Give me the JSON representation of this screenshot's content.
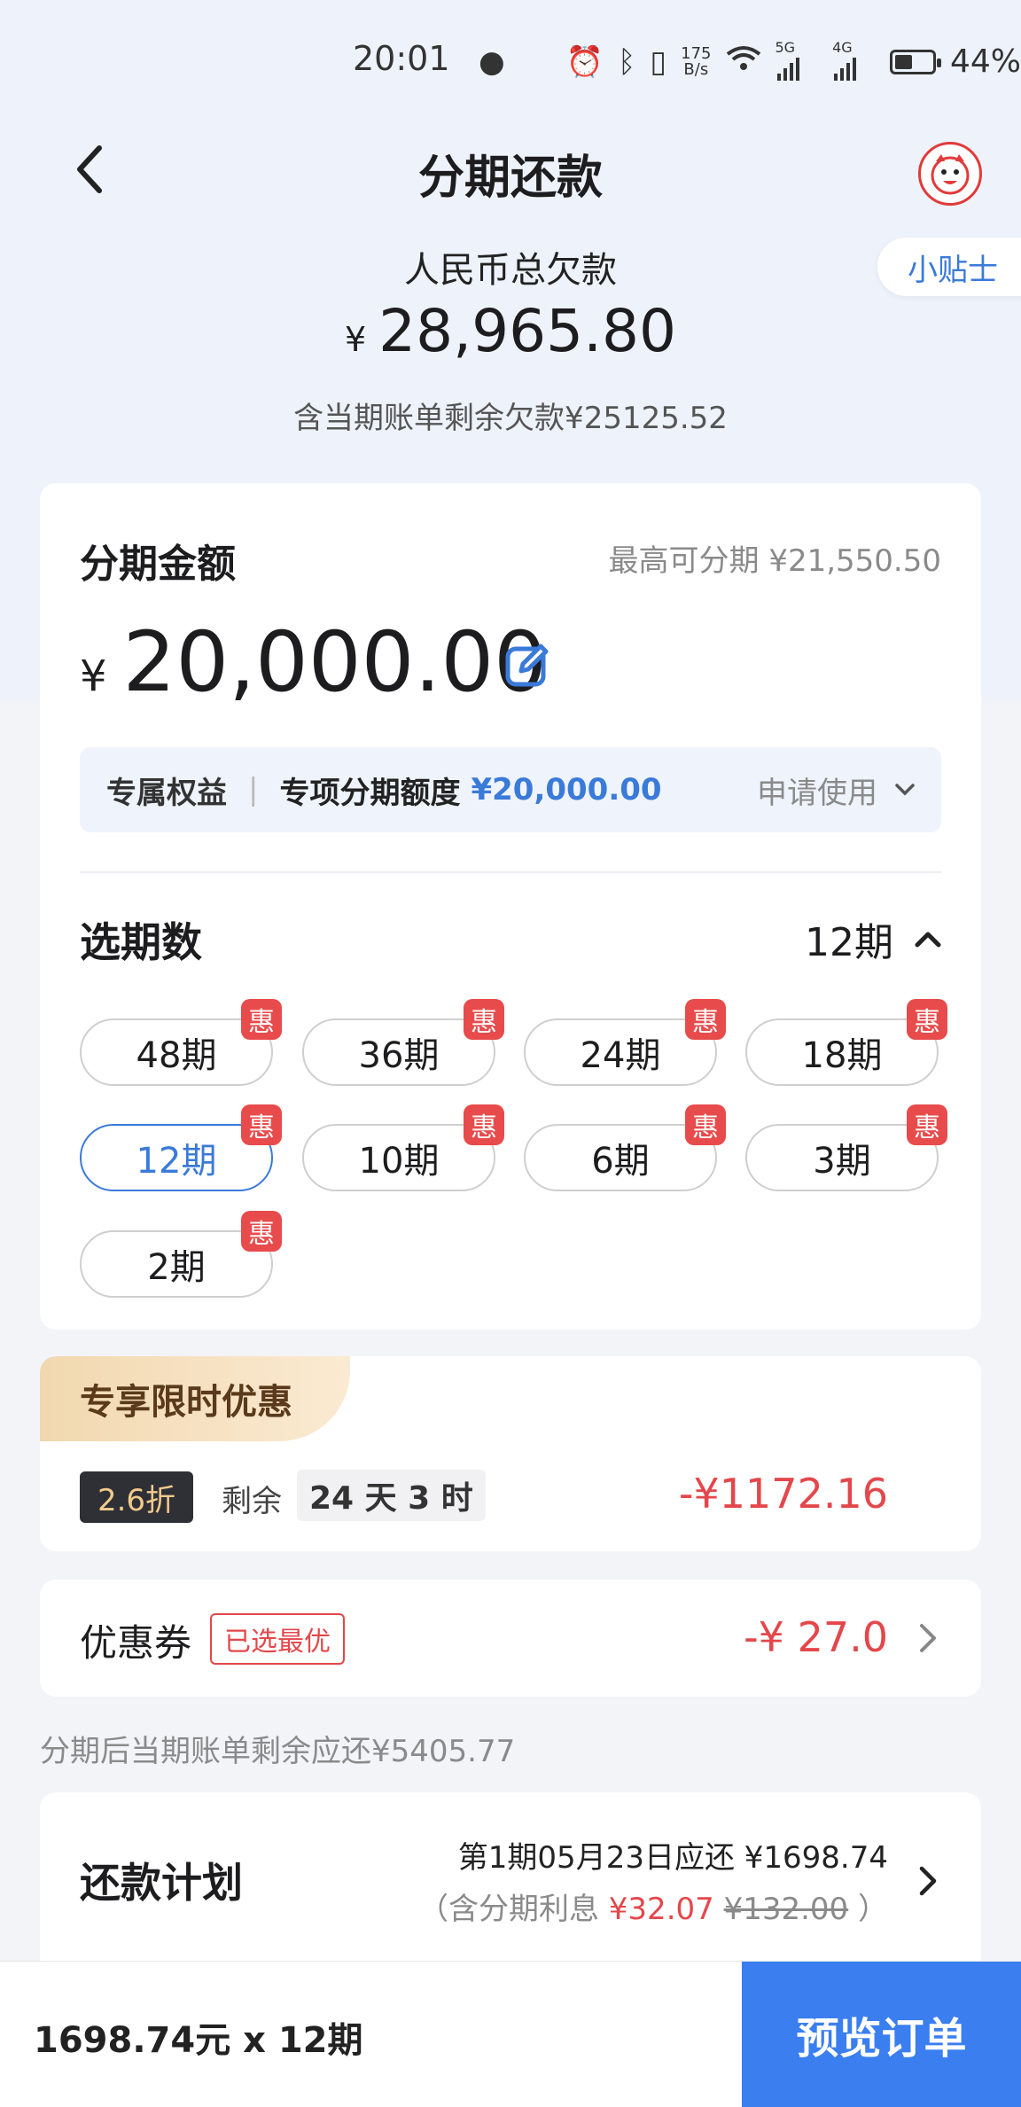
{
  "status_bar": {
    "time": "20:01",
    "net_speed_top": "175",
    "net_speed_bottom": "B/s",
    "signal_5g": "5G",
    "signal_4g": "4G",
    "battery_percent": "44%",
    "battery_level": 0.44
  },
  "nav": {
    "title": "分期还款"
  },
  "tip_button": "小贴士",
  "debt": {
    "label": "人民币总欠款",
    "currency": "¥",
    "amount": "28,965.80",
    "sub": "含当期账单剩余欠款¥25125.52"
  },
  "installment": {
    "label": "分期金额",
    "max_label": "最高可分期 ¥21,550.50",
    "currency": "¥",
    "amount": "20,000.00",
    "benefit": {
      "tag": "专属权益",
      "separator": "|",
      "name": "专项分期额度",
      "value": "¥20,000.00",
      "apply": "申请使用"
    },
    "period_label": "选期数",
    "period_selected": "12期",
    "badge": "惠",
    "periods": [
      "48期",
      "36期",
      "24期",
      "18期",
      "12期",
      "10期",
      "6期",
      "3期",
      "2期"
    ]
  },
  "promo": {
    "title": "专享限时优惠",
    "discount": "2.6折",
    "remain_label": "剩余",
    "countdown": "24 天 3 时",
    "saving": "-¥1172.16"
  },
  "coupon": {
    "label": "优惠券",
    "tag": "已选最优",
    "value": "-¥ 27.0"
  },
  "after_note": "分期后当期账单剩余应还¥5405.77",
  "plan": {
    "label": "还款计划",
    "line1": "第1期05月23日应还 ¥1698.74",
    "line2_prefix": "（含分期利息 ",
    "interest": "¥32.07",
    "original": "¥132.00",
    "line2_suffix": " ）"
  },
  "bottom": {
    "total": "1698.74元 x 12期",
    "button": "预览订单"
  },
  "colors": {
    "accent": "#3a7ef0",
    "red": "#e4474b"
  }
}
